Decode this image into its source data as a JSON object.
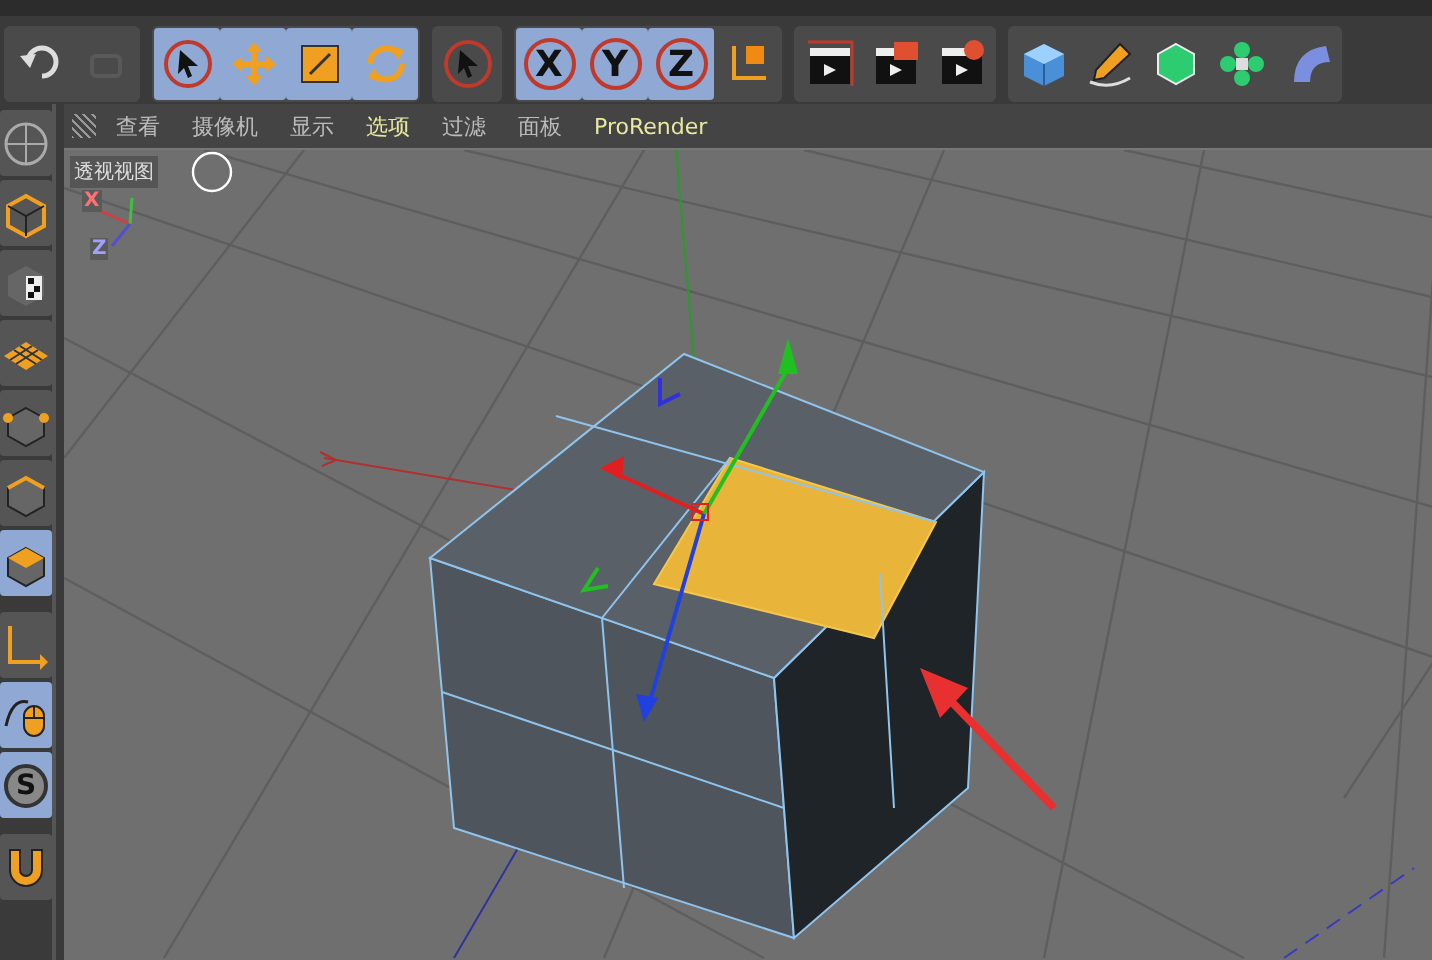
{
  "toolbar": {
    "groups": [
      [
        {
          "kind": "undo",
          "selected": false,
          "disabled": false
        },
        {
          "kind": "redo",
          "selected": false,
          "disabled": true
        }
      ],
      [
        {
          "kind": "select",
          "selected": true,
          "disabled": false
        },
        {
          "kind": "move",
          "selected": true,
          "disabled": false
        },
        {
          "kind": "scale",
          "selected": true,
          "disabled": false
        },
        {
          "kind": "rotate",
          "selected": true,
          "disabled": false
        }
      ],
      [
        {
          "kind": "select",
          "selected": false,
          "disabled": false
        }
      ],
      [
        {
          "kind": "axis",
          "label": "X",
          "selected": true,
          "disabled": false
        },
        {
          "kind": "axis",
          "label": "Y",
          "selected": true,
          "disabled": false
        },
        {
          "kind": "axis",
          "label": "Z",
          "selected": true,
          "disabled": false
        },
        {
          "kind": "coords",
          "selected": false,
          "disabled": false
        }
      ],
      [
        {
          "kind": "render-view",
          "selected": false,
          "disabled": false
        },
        {
          "kind": "render",
          "selected": false,
          "disabled": false
        },
        {
          "kind": "render-settings",
          "selected": false,
          "disabled": false
        }
      ],
      [
        {
          "kind": "cube",
          "selected": false,
          "disabled": false
        },
        {
          "kind": "pen",
          "selected": false,
          "disabled": false
        },
        {
          "kind": "subdivide",
          "selected": false,
          "disabled": false
        },
        {
          "kind": "cloner",
          "selected": false,
          "disabled": false
        },
        {
          "kind": "deform",
          "selected": false,
          "disabled": false
        }
      ]
    ]
  },
  "side_toolbar": [
    {
      "kind": "sphere-grid",
      "selected": false
    },
    {
      "kind": "model",
      "selected": false
    },
    {
      "kind": "texture",
      "selected": false
    },
    {
      "kind": "workplane",
      "selected": false
    },
    {
      "kind": "points",
      "selected": false
    },
    {
      "kind": "edges",
      "selected": false
    },
    {
      "kind": "polygons",
      "selected": true
    },
    {
      "kind": "axis",
      "selected": false
    },
    {
      "kind": "tweak",
      "selected": true
    },
    {
      "kind": "snap",
      "label": "S",
      "selected": true
    },
    {
      "kind": "magnet",
      "selected": false
    }
  ],
  "viewport": {
    "menu": [
      {
        "label": "查看",
        "highlighted": false
      },
      {
        "label": "摄像机",
        "highlighted": false
      },
      {
        "label": "显示",
        "highlighted": false
      },
      {
        "label": "选项",
        "highlighted": true
      },
      {
        "label": "过滤",
        "highlighted": false
      },
      {
        "label": "面板",
        "highlighted": false
      },
      {
        "label": "ProRender",
        "highlighted": true
      }
    ],
    "view_name": "透视视图",
    "axis_labels": [
      "X",
      "Z"
    ]
  }
}
